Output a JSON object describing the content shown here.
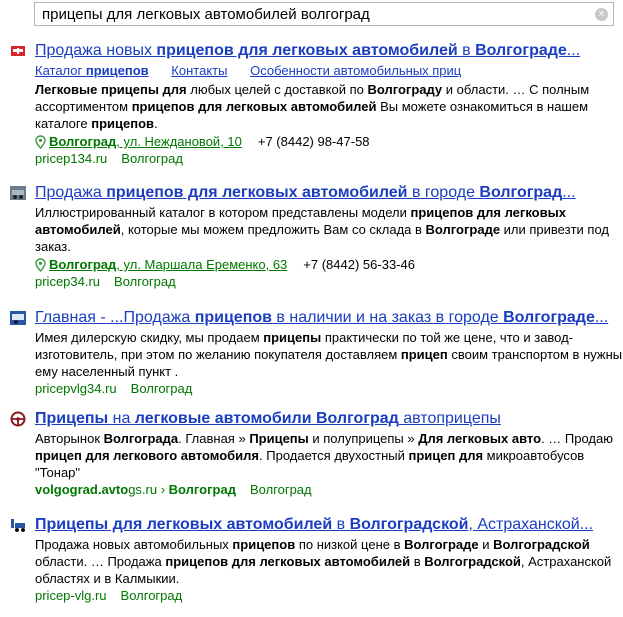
{
  "search": {
    "query": "прицепы для легковых автомобилей волгоград",
    "clear": "×"
  },
  "results": [
    {
      "title": [
        {
          "t": "Продажа новых ",
          "b": false
        },
        {
          "t": "прицепов для легковых автомобилей",
          "b": true
        },
        {
          "t": " в ",
          "b": false
        },
        {
          "t": "Волгограде",
          "b": true
        },
        {
          "t": "...",
          "b": false
        }
      ],
      "sitelinks": [
        [
          {
            "t": "Каталог ",
            "b": false
          },
          {
            "t": "прицепов",
            "b": true
          }
        ],
        [
          {
            "t": "Контакты",
            "b": false
          }
        ],
        [
          {
            "t": "Особенности автомобильных приц",
            "b": false
          }
        ]
      ],
      "snippet_lines": [
        [
          {
            "t": "Легковые прицепы для",
            "b": true
          },
          {
            "t": " любых целей с доставкой по ",
            "b": false
          },
          {
            "t": "Волгограду",
            "b": true
          },
          {
            "t": " и области. … С полным",
            "b": false
          }
        ],
        [
          {
            "t": "ассортиментом ",
            "b": false
          },
          {
            "t": "прицепов для легковых автомобилей",
            "b": true
          },
          {
            "t": " Вы можете ознакомиться в нашем",
            "b": false
          }
        ],
        [
          {
            "t": "каталоге ",
            "b": false
          },
          {
            "t": "прицепов",
            "b": true
          },
          {
            "t": ".",
            "b": false
          }
        ]
      ],
      "address": {
        "city": "Волгоград",
        "street": ", ул. Неждановой, 10",
        "phone": "+7 (8442) 98-47-58"
      },
      "url": "pricep134.ru",
      "region": "Волгоград"
    },
    {
      "title": [
        {
          "t": "Продажа ",
          "b": false
        },
        {
          "t": "прицепов для легковых автомобилей",
          "b": true
        },
        {
          "t": " в городе ",
          "b": false
        },
        {
          "t": "Волгоград",
          "b": true
        },
        {
          "t": "...",
          "b": false
        }
      ],
      "snippet_lines": [
        [
          {
            "t": "Иллюстрированный каталог в котором представлены модели ",
            "b": false
          },
          {
            "t": "прицепов для легковых",
            "b": true
          }
        ],
        [
          {
            "t": "автомобилей",
            "b": true
          },
          {
            "t": ", которые мы можем предложить Вам со склада в ",
            "b": false
          },
          {
            "t": "Волгограде",
            "b": true
          },
          {
            "t": " или привезти под",
            "b": false
          }
        ],
        [
          {
            "t": "заказ.",
            "b": false
          }
        ]
      ],
      "address": {
        "city": "Волгоград",
        "street": ", ул. Маршала Еременко, 63",
        "phone": "+7 (8442) 56-33-46"
      },
      "url": "pricep34.ru",
      "region": "Волгоград"
    },
    {
      "title": [
        {
          "t": "Главная - ...Продажа ",
          "b": false
        },
        {
          "t": "прицепов",
          "b": true
        },
        {
          "t": " в наличии и на заказ в городе ",
          "b": false
        },
        {
          "t": "Волгограде",
          "b": true
        },
        {
          "t": "...",
          "b": false
        }
      ],
      "snippet_lines": [
        [
          {
            "t": "Имея дилерскую скидку, мы продаем ",
            "b": false
          },
          {
            "t": "прицепы",
            "b": true
          },
          {
            "t": " практически по той же цене, что и завод-",
            "b": false
          }
        ],
        [
          {
            "t": "изготовитель, при этом по желанию покупателя доставляем ",
            "b": false
          },
          {
            "t": "прицеп",
            "b": true
          },
          {
            "t": " своим транспортом в нужный",
            "b": false
          }
        ],
        [
          {
            "t": "ему населенный пункт .",
            "b": false
          }
        ]
      ],
      "url": "pricepvlg34.ru",
      "region": "Волгоград"
    },
    {
      "title": [
        {
          "t": "Прицепы",
          "b": true
        },
        {
          "t": " на ",
          "b": false
        },
        {
          "t": "легковые автомобили Волгоград",
          "b": true
        },
        {
          "t": " автоприцепы",
          "b": false
        }
      ],
      "snippet_lines": [
        [
          {
            "t": "Авторынок ",
            "b": false
          },
          {
            "t": "Волгограда",
            "b": true
          },
          {
            "t": ". Главная » ",
            "b": false
          },
          {
            "t": "Прицепы",
            "b": true
          },
          {
            "t": " и полуприцепы » ",
            "b": false
          },
          {
            "t": "Для легковых авто",
            "b": true
          },
          {
            "t": ". … Продаю",
            "b": false
          }
        ],
        [
          {
            "t": "прицеп для легкового автомобиля",
            "b": true
          },
          {
            "t": ". Продается двухостный ",
            "b": false
          },
          {
            "t": "прицеп для",
            "b": true
          },
          {
            "t": " микроавтобусов",
            "b": false
          }
        ],
        [
          {
            "t": "\"Тонар\"",
            "b": false
          }
        ]
      ],
      "url_parts": [
        {
          "t": "volgograd.avto",
          "b": true
        },
        {
          "t": "gs.ru › ",
          "b": false
        },
        {
          "t": "Волгоград",
          "b": true
        }
      ],
      "region": "Волгоград"
    },
    {
      "title": [
        {
          "t": "Прицепы для легковых автомобилей",
          "b": true
        },
        {
          "t": " в ",
          "b": false
        },
        {
          "t": "Волгоградской",
          "b": true
        },
        {
          "t": ", Астраханской...",
          "b": false
        }
      ],
      "snippet_lines": [
        [
          {
            "t": "Продажа новых автомобильных ",
            "b": false
          },
          {
            "t": "прицепов",
            "b": true
          },
          {
            "t": " по низкой цене в ",
            "b": false
          },
          {
            "t": "Волгограде",
            "b": true
          },
          {
            "t": " и ",
            "b": false
          },
          {
            "t": "Волгоградской",
            "b": true
          }
        ],
        [
          {
            "t": "области. … Продажа ",
            "b": false
          },
          {
            "t": "прицепов для легковых автомобилей",
            "b": true
          },
          {
            "t": " в ",
            "b": false
          },
          {
            "t": "Волгоградской",
            "b": true
          },
          {
            "t": ", Астраханской",
            "b": false
          }
        ],
        [
          {
            "t": "областях и в Калмыкии.",
            "b": false
          }
        ]
      ],
      "url": "pricep-vlg.ru",
      "region": "Волгоград"
    }
  ]
}
